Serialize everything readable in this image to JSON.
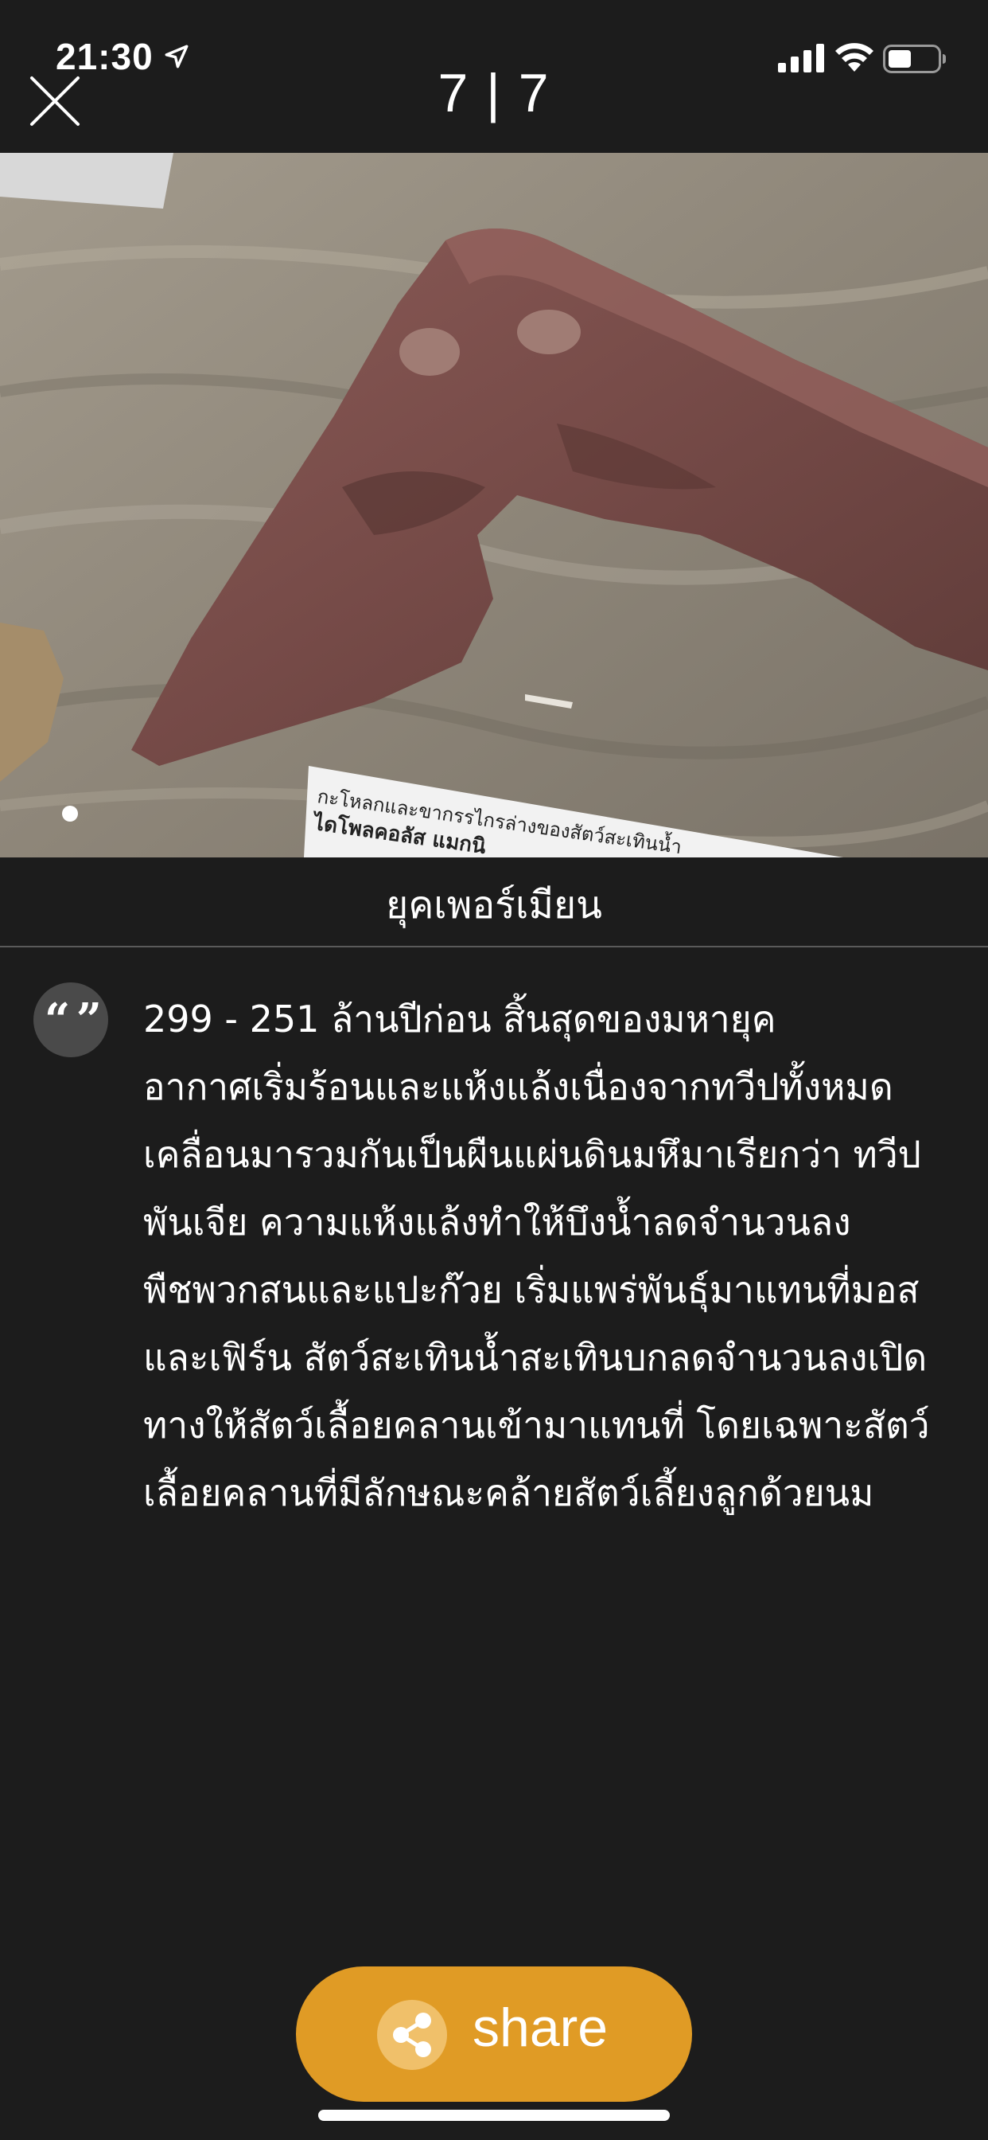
{
  "status_bar": {
    "time": "21:30",
    "icons": [
      "location-arrow-icon",
      "signal-bars-icon",
      "wifi-icon",
      "battery-icon"
    ]
  },
  "header": {
    "close_icon": "close-icon",
    "page_counter": "7 | 7"
  },
  "photo": {
    "description_icon": "fossil-skull-photo",
    "label_card_line1": "กะโหลกและขากรรไกรล่างของสัตว์สะเทินน้ำ",
    "label_card_line2": "ไดโพลคอลัส แมกนิ",
    "carousel_current": 1,
    "carousel_total": 1
  },
  "era": {
    "title": "ยุคเพอร์เมียน"
  },
  "description": {
    "quote_icon": "quote-icon",
    "quote_glyph": "“ ”",
    "lines": [
      "299 - 251 ล้านปีก่อน สิ้นสุดของมหายุค",
      "อากาศเริ่มร้อนและแห้งแล้งเนื่องจากทวีปทั้งหมด",
      "เคลื่อนมารวมกันเป็นผืนแผ่นดินมหึมาเรียกว่า ทวีป",
      "พันเจีย ความแห้งแล้งทำให้บึงน้ำลดจำนวนลง",
      "พืชพวกสนและแปะก๊วย เริ่มแพร่พันธุ์มาแทนที่มอส",
      "และเฟิร์น สัตว์สะเทินน้ำสะเทินบกลดจำนวนลงเปิด",
      "ทางให้สัตว์เลื้อยคลานเข้ามาแทนที่ โดยเฉพาะสัตว์",
      "เลื้อยคลานที่มีลักษณะคล้ายสัตว์เลี้ยงลูกด้วยนม"
    ]
  },
  "share": {
    "label": "share",
    "icon": "share-icon"
  },
  "colors": {
    "background": "#1c1c1c",
    "accent": "#e09b25",
    "divider": "#5a5a5a"
  }
}
